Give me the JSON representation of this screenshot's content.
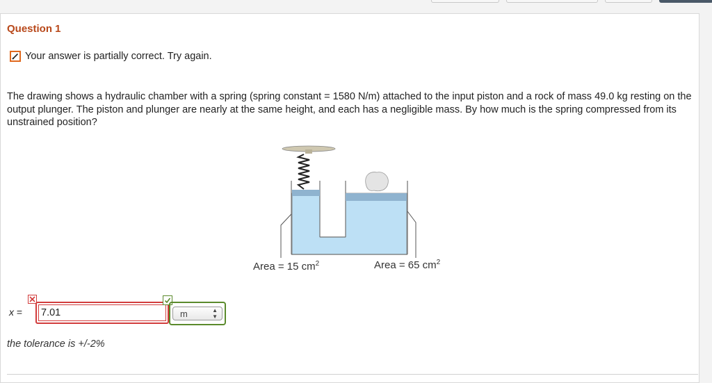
{
  "question": {
    "title": "Question 1"
  },
  "status": {
    "icon": "pencil-icon",
    "text": "Your answer is partially correct.  Try again."
  },
  "problem": {
    "text": "The drawing shows a hydraulic chamber with a spring (spring constant = 1580 N/m) attached to the input piston and a rock of mass 49.0 kg resting on the output plunger. The piston and plunger are nearly at the same height, and each has a negligible mass. By how much is the spring compressed from its unstrained position?"
  },
  "figure": {
    "left_area_text": "Area = 15 cm",
    "left_area_exp": "2",
    "right_area_text": "Area = 65 cm",
    "right_area_exp": "2"
  },
  "answer": {
    "variable": "x",
    "equals": "=",
    "value": "7.01",
    "value_status": "incorrect",
    "unit": "m",
    "unit_status": "correct"
  },
  "tolerance": {
    "text": "the tolerance is +/-2%"
  },
  "colors": {
    "title": "#b8481a",
    "incorrect": "#d23c3c",
    "correct": "#5a8a2c",
    "fluid": "#bde0f5",
    "piston": "#8fb3cf",
    "pencil_box": "#e0691e"
  }
}
